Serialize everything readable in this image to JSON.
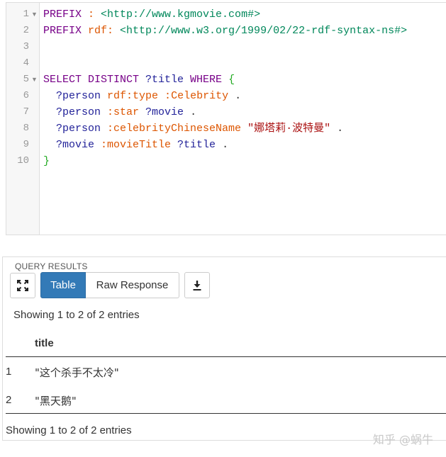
{
  "editor": {
    "line_numbers": [
      "1",
      "2",
      "3",
      "4",
      "5",
      "6",
      "7",
      "8",
      "9",
      "10"
    ],
    "line1": {
      "kw": "PREFIX",
      "pfx": " : ",
      "uri": "<http://www.kgmovie.com#>"
    },
    "line2": {
      "kw": "PREFIX",
      "pfx": " rdf: ",
      "uri": "<http://www.w3.org/1999/02/22-rdf-syntax-ns#>"
    },
    "line5": {
      "kw1": "SELECT DISTINCT",
      "var": " ?title",
      "kw2": " WHERE",
      "brace": " {"
    },
    "line6": {
      "var": "  ?person",
      "pfx": " rdf:",
      "atom": "type",
      "pfx2": " :",
      "atom2": "Celebrity",
      "punct": " ."
    },
    "line7": {
      "var": "  ?person",
      "pfx": " :",
      "atom": "star",
      "var2": " ?movie",
      "punct": " ."
    },
    "line8": {
      "var": "  ?person",
      "pfx": " :",
      "atom": "celebrityChineseName",
      "str": " \"娜塔莉·波特曼\"",
      "punct": " ."
    },
    "line9": {
      "var": "  ?movie",
      "pfx": " :",
      "atom": "movieTitle",
      "var2": " ?title",
      "punct": " ."
    },
    "line10": {
      "brace": "}"
    }
  },
  "results": {
    "title": "QUERY RESULTS",
    "buttons": {
      "table": "Table",
      "raw": "Raw Response"
    },
    "icons": {
      "expand": "expand-icon",
      "download": "download-icon"
    },
    "showing_top": "Showing 1 to 2 of 2 entries",
    "showing_bottom": "Showing 1 to 2 of 2 entries",
    "columns": [
      "title"
    ],
    "rows": [
      {
        "num": "1",
        "title": "\"这个杀手不太冷\""
      },
      {
        "num": "2",
        "title": "\"黑天鹅\""
      }
    ]
  },
  "watermark": "知乎 @蜗牛",
  "colors": {
    "accent": "#337ab7",
    "keyword": "#770088",
    "uri": "#00875a",
    "string": "#aa1111"
  }
}
